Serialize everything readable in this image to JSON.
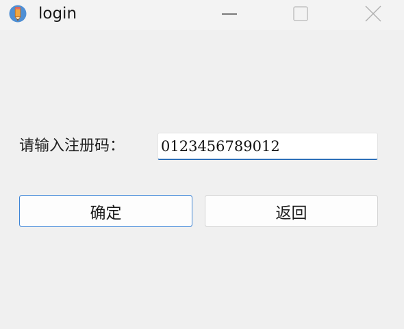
{
  "window": {
    "title": "login",
    "icons": {
      "app": "pencil-app-icon",
      "minimize": "minimize-icon",
      "maximize": "maximize-icon",
      "close": "close-icon"
    }
  },
  "form": {
    "label": "请输入注册码：",
    "code_value": "0123456789012"
  },
  "buttons": {
    "ok_label": "确定",
    "back_label": "返回"
  },
  "colors": {
    "background": "#f0f0f0",
    "accent": "#3c84d6",
    "app_icon_bg": "#4f8fd4",
    "app_icon_pencil": "#e89a3a"
  }
}
